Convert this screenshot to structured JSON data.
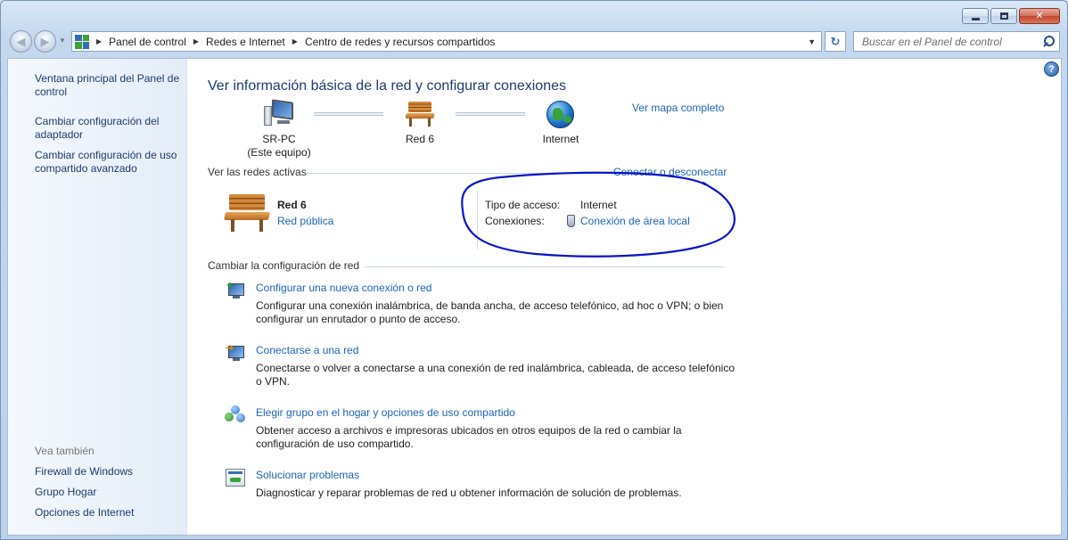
{
  "window": {
    "minimize_glyph": "",
    "maximize_glyph": "",
    "close_glyph": "✕"
  },
  "nav": {
    "back_glyph": "◀",
    "forward_glyph": "▶",
    "breadcrumbs": [
      "Panel de control",
      "Redes e Internet",
      "Centro de redes y recursos compartidos"
    ],
    "refresh_glyph": "↻",
    "search_placeholder": "Buscar en el Panel de control"
  },
  "sidebar": {
    "links": [
      "Ventana principal del Panel de control",
      "Cambiar configuración del adaptador",
      "Cambiar configuración de uso compartido avanzado"
    ],
    "see_also_title": "Vea también",
    "see_also": [
      "Firewall de Windows",
      "Grupo Hogar",
      "Opciones de Internet"
    ]
  },
  "main": {
    "help_glyph": "?",
    "title": "Ver información básica de la red y configurar conexiones",
    "full_map_link": "Ver mapa completo",
    "network_map": {
      "pc_name": "SR-PC",
      "pc_sub": "(Este equipo)",
      "network_name": "Red  6",
      "internet_label": "Internet"
    },
    "active_networks": {
      "title": "Ver las redes activas",
      "connect_link": "Conectar o desconectar",
      "name": "Red  6",
      "type_link": "Red pública",
      "access_type_label": "Tipo de acceso:",
      "access_type_value": "Internet",
      "connections_label": "Conexiones:",
      "connection_link": "Conexión de área local"
    },
    "change_settings": {
      "title": "Cambiar la configuración de red",
      "tasks": [
        {
          "icon": "new-connection-icon",
          "link": "Configurar una nueva conexión o red",
          "desc1": "Configurar una conexión inalámbrica, de banda ancha, de acceso telefónico, ad hoc o VPN; o bien",
          "desc2": "configurar un enrutador o punto de acceso."
        },
        {
          "icon": "connect-network-icon",
          "link": "Conectarse a una red",
          "desc1": "Conectarse o volver a conectarse a una conexión de red inalámbrica, cableada, de acceso telefónico",
          "desc2": "o VPN."
        },
        {
          "icon": "homegroup-icon",
          "link": "Elegir grupo en el hogar y opciones de uso compartido",
          "desc1": "Obtener acceso a archivos e impresoras ubicados en otros equipos de la red o cambiar la",
          "desc2": "configuración de uso compartido."
        },
        {
          "icon": "troubleshoot-icon",
          "link": "Solucionar problemas",
          "desc1": "Diagnosticar y reparar problemas de red u obtener información de solución de problemas.",
          "desc2": ""
        }
      ]
    }
  },
  "colors": {
    "link": "#1c63b8",
    "title": "#1e3a6e",
    "annotation": "#0a14c8"
  }
}
